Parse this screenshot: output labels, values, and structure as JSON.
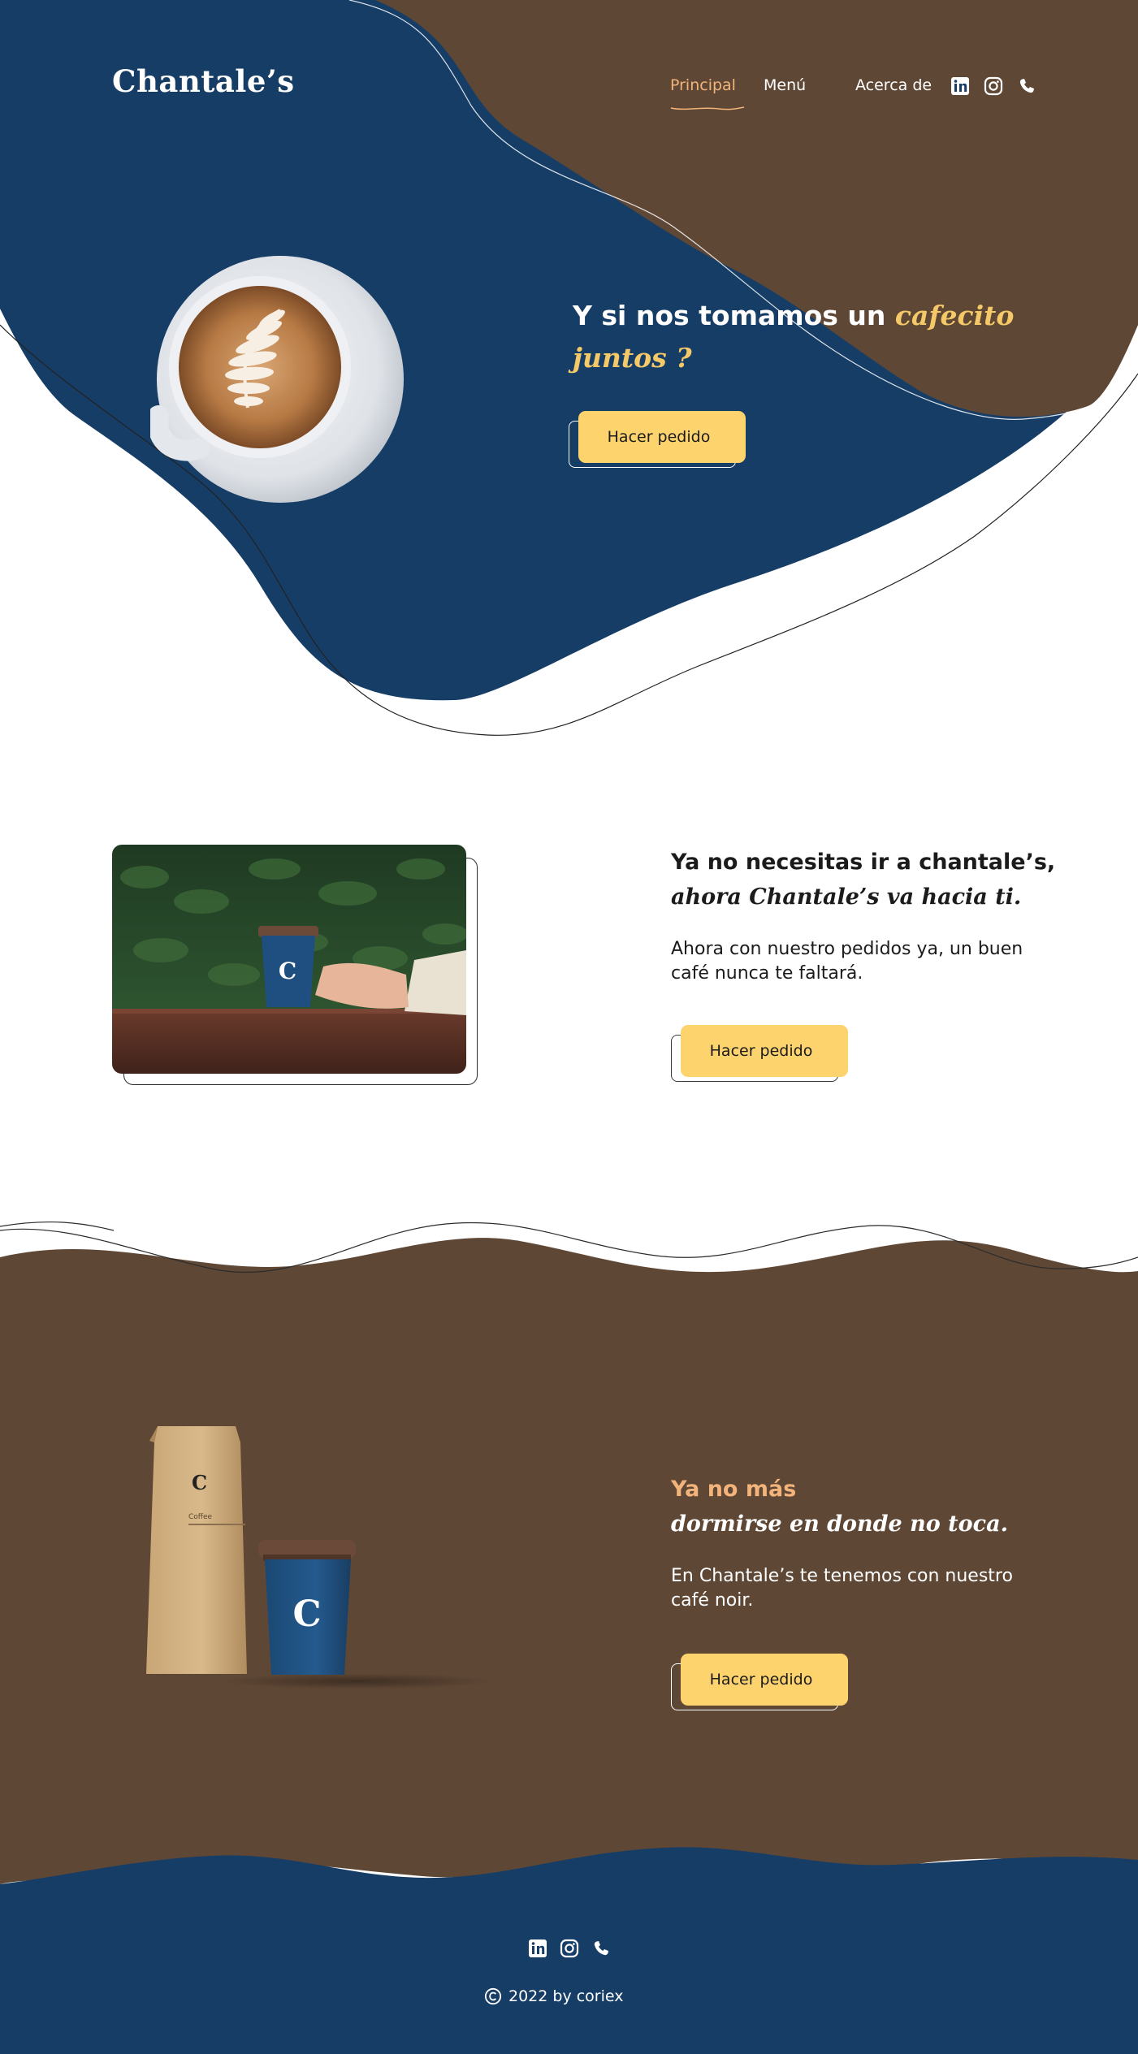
{
  "header": {
    "logo": "Chantale’s",
    "nav": [
      {
        "label": "Principal",
        "active": true
      },
      {
        "label": "Menú",
        "active": false
      },
      {
        "label": "Acerca de",
        "active": false
      }
    ],
    "social_icons": [
      "linkedin-icon",
      "instagram-icon",
      "phone-icon"
    ]
  },
  "hero": {
    "title_plain": "Y si nos tomamos un ",
    "title_script_1": "cafecito",
    "title_script_2": "juntos ?",
    "button_label": "Hacer pedido"
  },
  "delivery": {
    "title_line1": "Ya no necesitas ir a chantale’s,",
    "title_line2": "ahora Chantale’s va hacia ti.",
    "body": "Ahora con nuestro pedidos ya, un buen café nunca te faltará.",
    "button_label": "Hacer pedido"
  },
  "noir": {
    "title_line1": "Ya no más",
    "title_line2": "dormirse en donde no toca.",
    "body": "En Chantale’s te tenemos con nuestro café noir.",
    "button_label": "Hacer pedido",
    "bag_label": "Coffee"
  },
  "footer": {
    "social_icons": [
      "linkedin-icon",
      "instagram-icon",
      "phone-icon"
    ],
    "copyright": "2022 by coriex"
  },
  "colors": {
    "navy": "#163d66",
    "brown": "#5f4735",
    "yellow": "#fdd36d",
    "orange_text": "#f2b47a",
    "script_yellow": "#f5c967"
  }
}
